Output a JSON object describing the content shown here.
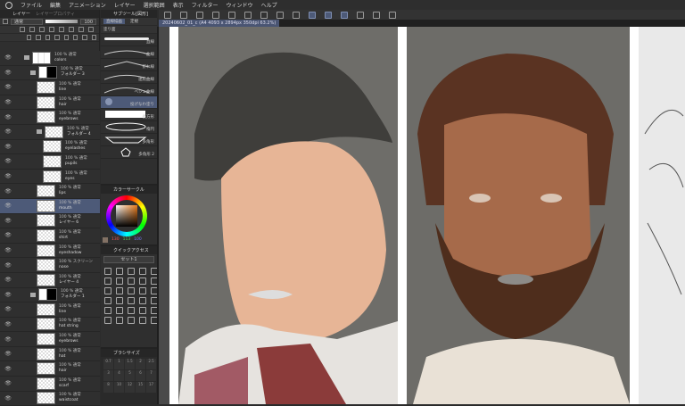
{
  "menu": [
    "ファイル",
    "編集",
    "アニメーション",
    "レイヤー",
    "選択範囲",
    "表示",
    "フィルター",
    "ウィンドウ",
    "ヘルプ"
  ],
  "document_tab": "20240602_01_c (A4 4093 x 2894px 350dpi 63.2%)",
  "layer_panel": {
    "tabs": [
      "レイヤー",
      "レイヤープロパティ"
    ],
    "blend_mode": "通常",
    "opacity": "100",
    "layers": [
      {
        "mode": "100 % 通常",
        "name": "colors",
        "type": "folder",
        "thumb": "colors",
        "indent": 1
      },
      {
        "mode": "100 % 通常",
        "name": "フォルダー 3",
        "type": "folder",
        "thumb": "mask",
        "indent": 2
      },
      {
        "mode": "100 % 通常",
        "name": "line",
        "indent": 3
      },
      {
        "mode": "100 % 通常",
        "name": "hair",
        "indent": 3
      },
      {
        "mode": "100 % 通常",
        "name": "eyebrows",
        "indent": 3
      },
      {
        "mode": "100 % 通常",
        "name": "フォルダー 4",
        "type": "folder",
        "indent": 3
      },
      {
        "mode": "100 % 通常",
        "name": "eyelashes",
        "indent": 4
      },
      {
        "mode": "100 % 通常",
        "name": "pupils",
        "indent": 4
      },
      {
        "mode": "100 % 通常",
        "name": "eyes",
        "indent": 4
      },
      {
        "mode": "100 % 通常",
        "name": "lips",
        "indent": 3
      },
      {
        "mode": "100 % 通常",
        "name": "mouth",
        "indent": 3,
        "active": true
      },
      {
        "mode": "100 % 通常",
        "name": "レイヤー 6",
        "indent": 3
      },
      {
        "mode": "100 % 通常",
        "name": "shirt",
        "indent": 3
      },
      {
        "mode": "100 % 通常",
        "name": "eyeshadow",
        "indent": 3
      },
      {
        "mode": "100 % スクリーン",
        "name": "nose",
        "indent": 3
      },
      {
        "mode": "100 % 通常",
        "name": "レイヤー 4",
        "indent": 3
      },
      {
        "mode": "100 % 通常",
        "name": "フォルダー 1",
        "type": "folder",
        "thumb": "mask",
        "indent": 2
      },
      {
        "mode": "100 % 通常",
        "name": "line",
        "indent": 3
      },
      {
        "mode": "100 % 通常",
        "name": "hat string",
        "indent": 3
      },
      {
        "mode": "100 % 通常",
        "name": "eyebrows",
        "indent": 3
      },
      {
        "mode": "100 % 通常",
        "name": "hat",
        "indent": 3
      },
      {
        "mode": "100 % 通常",
        "name": "hair",
        "indent": 3
      },
      {
        "mode": "100 % 通常",
        "name": "scarf",
        "indent": 3
      },
      {
        "mode": "100 % 通常",
        "name": "waistcoat",
        "indent": 3
      }
    ]
  },
  "subtool_panel": {
    "title": "サブツール[図形]",
    "tabs": [
      "直線描画",
      "定規"
    ],
    "group": "塗り面",
    "items": [
      "直線",
      "曲線",
      "折れ線",
      "連続曲線",
      "ベジェ曲線",
      "投げなわ塗り",
      "長方形",
      "楕円",
      "多角形",
      "多角形 2"
    ],
    "active_index": 5
  },
  "color_panel": {
    "title": "カラーサークル",
    "r": "130",
    "g": "113",
    "b": "100",
    "current_color": "#827164"
  },
  "quick_access": {
    "title": "クイックアクセス",
    "set": "セット1"
  },
  "brush_size": {
    "title": "ブラシサイズ",
    "values": [
      "0.7",
      "1",
      "1.5",
      "2",
      "2.5",
      "3",
      "4",
      "5",
      "6",
      "7",
      "8",
      "10",
      "12",
      "15",
      "17"
    ]
  }
}
